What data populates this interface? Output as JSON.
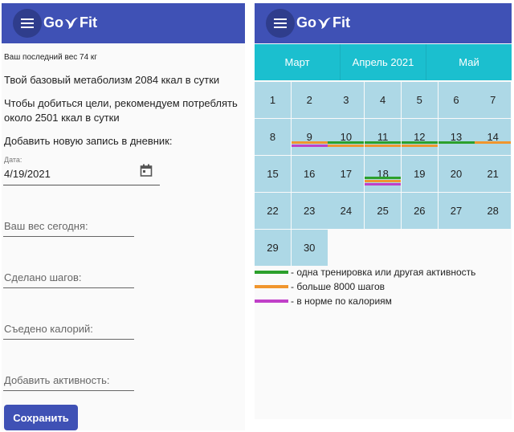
{
  "app": {
    "name_a": "Go",
    "name_b": "Fit"
  },
  "colors": {
    "primary": "#3f51b5",
    "teal": "#1bbfcf",
    "day": "#add8e6",
    "green": "#2ca02c",
    "orange": "#f0962e",
    "purple": "#c040c8"
  },
  "left": {
    "last_weight": "Ваш последний вес 74 кг",
    "metabolism": "Твой базовый метаболизм 2084 ккал в сутки",
    "recommend_line1": "Чтобы добиться цели, рекомендуем потреблять",
    "recommend_line2": "около 2501 ккал в сутки",
    "add_entry": "Добавить новую запись в дневник:",
    "date_label": "Дата:",
    "date_value": "4/19/2021",
    "weight_placeholder": "Ваш вес сегодня:",
    "steps_placeholder": "Сделано шагов:",
    "calories_placeholder": "Съедено калорий:",
    "activity_placeholder": "Добавить активность:",
    "save_label": "Сохранить"
  },
  "calendar": {
    "months": [
      "Март",
      "Апрель 2021",
      "Май"
    ],
    "days": [
      {
        "n": "1",
        "marks": []
      },
      {
        "n": "2",
        "marks": []
      },
      {
        "n": "3",
        "marks": []
      },
      {
        "n": "4",
        "marks": []
      },
      {
        "n": "5",
        "marks": []
      },
      {
        "n": "6",
        "marks": []
      },
      {
        "n": "7",
        "marks": []
      },
      {
        "n": "8",
        "marks": []
      },
      {
        "n": "9",
        "marks": [
          "orange",
          "purple"
        ]
      },
      {
        "n": "10",
        "marks": [
          "green",
          "orange"
        ]
      },
      {
        "n": "11",
        "marks": [
          "green",
          "orange"
        ]
      },
      {
        "n": "12",
        "marks": [
          "green",
          "orange"
        ]
      },
      {
        "n": "13",
        "marks": [
          "green"
        ]
      },
      {
        "n": "14",
        "marks": [
          "orange"
        ]
      },
      {
        "n": "15",
        "marks": []
      },
      {
        "n": "16",
        "marks": []
      },
      {
        "n": "17",
        "marks": []
      },
      {
        "n": "18",
        "marks": [
          "green",
          "orange",
          "purple"
        ]
      },
      {
        "n": "19",
        "marks": []
      },
      {
        "n": "20",
        "marks": []
      },
      {
        "n": "21",
        "marks": []
      },
      {
        "n": "22",
        "marks": []
      },
      {
        "n": "23",
        "marks": []
      },
      {
        "n": "24",
        "marks": []
      },
      {
        "n": "25",
        "marks": []
      },
      {
        "n": "26",
        "marks": []
      },
      {
        "n": "27",
        "marks": []
      },
      {
        "n": "28",
        "marks": []
      },
      {
        "n": "29",
        "marks": []
      },
      {
        "n": "30",
        "marks": []
      }
    ],
    "legend": [
      {
        "color": "green",
        "text": "- одна тренировка или другая активность"
      },
      {
        "color": "orange",
        "text": "- больше 8000 шагов"
      },
      {
        "color": "purple",
        "text": "- в норме по калориям"
      }
    ]
  }
}
